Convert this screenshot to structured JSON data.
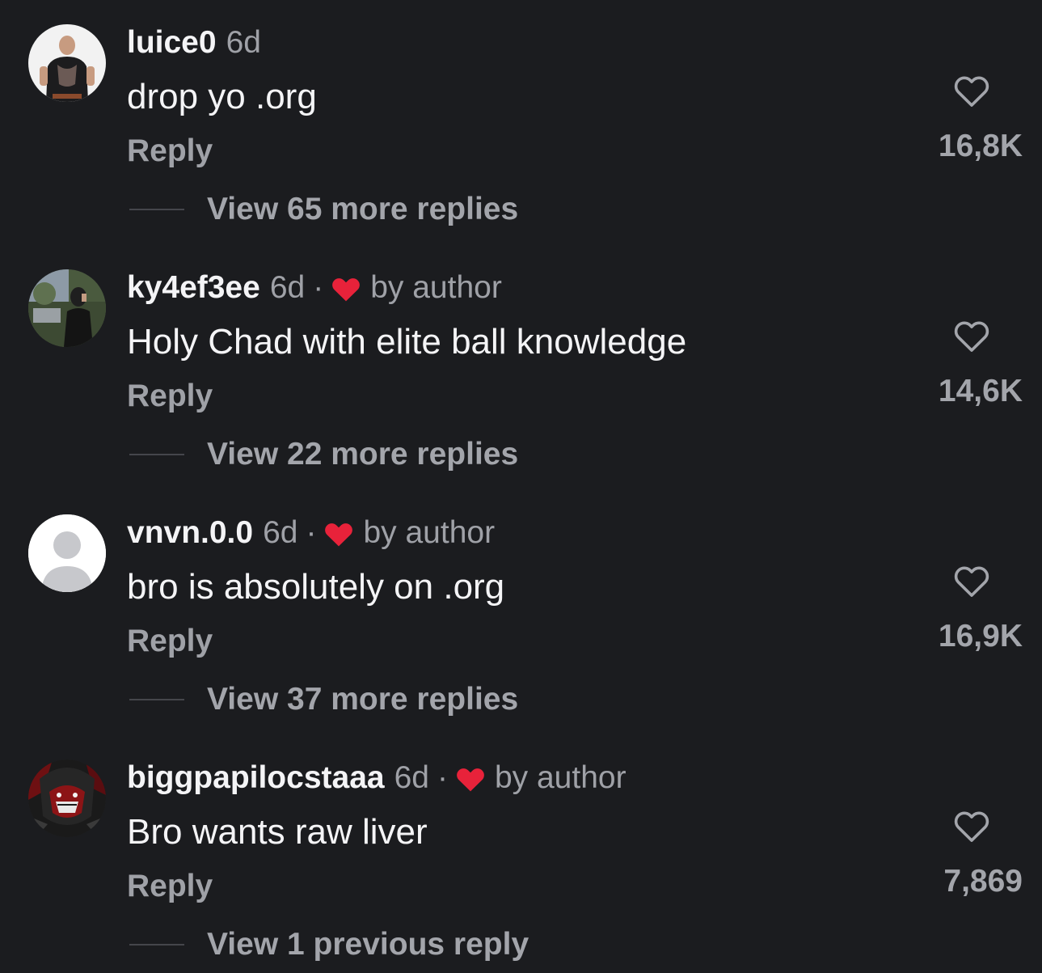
{
  "comments": [
    {
      "username": "luice0",
      "time": "6d",
      "liked_by_author": false,
      "author_label": "",
      "text": "drop yo .org",
      "reply_label": "Reply",
      "like_count": "16,8K",
      "view_replies": "View 65 more replies",
      "avatar": "person-photo-avatar"
    },
    {
      "username": "ky4ef3ee",
      "time": "6d",
      "separator": "·",
      "liked_by_author": true,
      "author_label": "by author",
      "text": "Holy Chad with elite ball knowledge",
      "reply_label": "Reply",
      "like_count": "14,6K",
      "view_replies": "View 22 more replies",
      "avatar": "outdoor-photo-avatar"
    },
    {
      "username": "vnvn.0.0",
      "time": "6d",
      "separator": "·",
      "liked_by_author": true,
      "author_label": "by author",
      "text": "bro is absolutely on .org",
      "reply_label": "Reply",
      "like_count": "16,9K",
      "view_replies": "View 37 more replies",
      "avatar": "default-user-avatar"
    },
    {
      "username": "biggpapilocstaaa",
      "time": "6d",
      "separator": "·",
      "liked_by_author": true,
      "author_label": "by author",
      "text": "Bro wants raw liver",
      "reply_label": "Reply",
      "like_count": "7,869",
      "view_replies": "View 1 previous reply",
      "avatar": "anime-art-avatar"
    }
  ],
  "colors": {
    "background": "#1b1c1f",
    "text_primary": "#f4f4f6",
    "text_secondary": "#9fa1a7",
    "author_heart": "#e8223a"
  },
  "icons": {
    "like": "heart-outline-icon",
    "author_like": "heart-filled-icon"
  }
}
